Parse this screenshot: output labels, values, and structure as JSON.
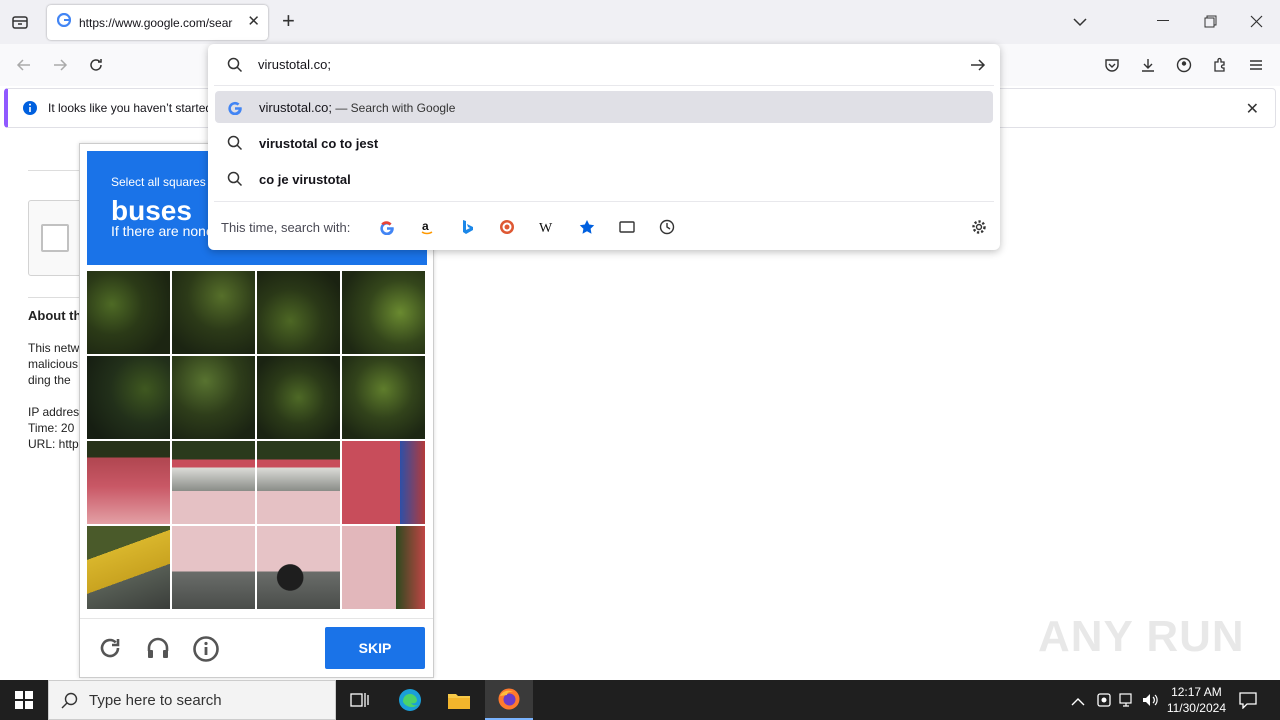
{
  "browser": {
    "tab": {
      "title": "https://www.google.com/sear",
      "close": "✕"
    },
    "new_tab": "+",
    "notification": {
      "text": "It looks like you haven’t started",
      "close": "✕"
    }
  },
  "urlbar": {
    "value": "virustotal.co;",
    "suggestions": [
      {
        "text": "virustotal.co;",
        "suffix": " — Search with Google",
        "icon": "google-icon",
        "selected": true
      },
      {
        "text": "virustotal co to jest",
        "icon": "search-icon",
        "selected": false
      },
      {
        "text": "co je virustotal",
        "icon": "search-icon",
        "selected": false
      }
    ],
    "search_with_label": "This time, search with:",
    "engines": [
      "google",
      "amazon",
      "bing",
      "duckduckgo",
      "wikipedia",
      "bookmarks",
      "tabs",
      "history"
    ]
  },
  "page": {
    "about_heading": "About th",
    "lines": [
      "This netw",
      "malicious",
      "ding the"
    ],
    "info": [
      "IP addres",
      "Time: 20",
      "URL: http"
    ]
  },
  "captcha": {
    "instruction": "Select all squares",
    "target": "buses",
    "subtext": "If there are none",
    "skip_label": "SKIP"
  },
  "taskbar": {
    "search_placeholder": "Type here to search",
    "time": "12:17 AM",
    "date": "11/30/2024"
  },
  "watermark": "ANY RUN",
  "colors": {
    "accent": "#1a73e8",
    "notif_border": "#9059ff",
    "taskbar": "#1f1f1f"
  }
}
